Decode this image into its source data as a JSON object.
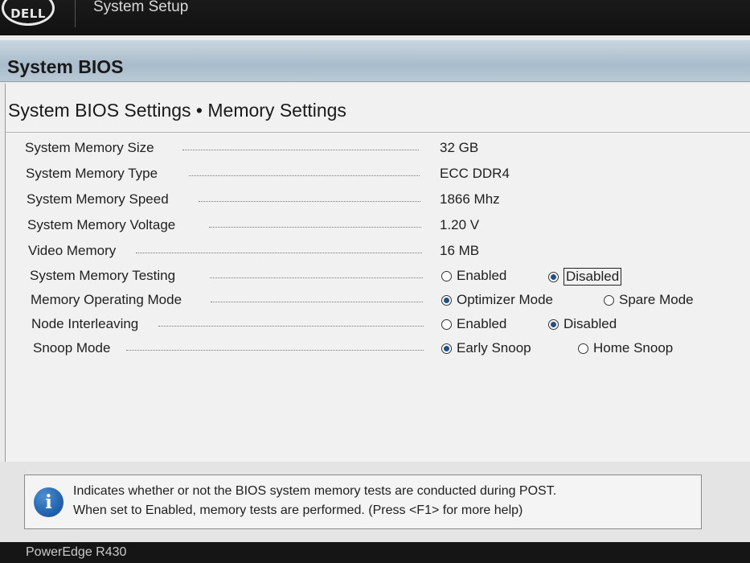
{
  "header": {
    "logo": "DELL",
    "app_title": "System Setup"
  },
  "bios_bar": {
    "title": "System BIOS"
  },
  "page_title": "System BIOS Settings • Memory Settings",
  "settings": [
    {
      "label": "System Memory Size",
      "value": "32 GB"
    },
    {
      "label": "System Memory Type",
      "value": "ECC DDR4"
    },
    {
      "label": "System Memory Speed",
      "value": "1866 Mhz"
    },
    {
      "label": "System Memory Voltage",
      "value": "1.20 V"
    },
    {
      "label": "Video Memory",
      "value": "16 MB"
    },
    {
      "label": "System Memory Testing",
      "options": [
        {
          "label": "Enabled",
          "selected": false
        },
        {
          "label": "Disabled",
          "selected": true
        }
      ]
    },
    {
      "label": "Memory Operating Mode",
      "options": [
        {
          "label": "Optimizer Mode",
          "selected": true
        },
        {
          "label": "Spare Mode",
          "selected": false
        }
      ]
    },
    {
      "label": "Node Interleaving",
      "options": [
        {
          "label": "Enabled",
          "selected": false
        },
        {
          "label": "Disabled",
          "selected": true
        }
      ]
    },
    {
      "label": "Snoop Mode",
      "options": [
        {
          "label": "Early Snoop",
          "selected": true
        },
        {
          "label": "Home Snoop",
          "selected": false
        }
      ]
    }
  ],
  "help": {
    "icon": "info-icon",
    "line1": "Indicates whether or not the BIOS system memory tests are conducted during POST.",
    "line2": "When set to Enabled, memory tests are performed. (Press <F1> for more help)"
  },
  "footer": {
    "model": "PowerEdge R430"
  },
  "colors": {
    "header_bg": "#111111",
    "title_bar": "#b9c8d3",
    "panel_bg": "#f1f1f1",
    "accent": "#1f4f8f"
  }
}
